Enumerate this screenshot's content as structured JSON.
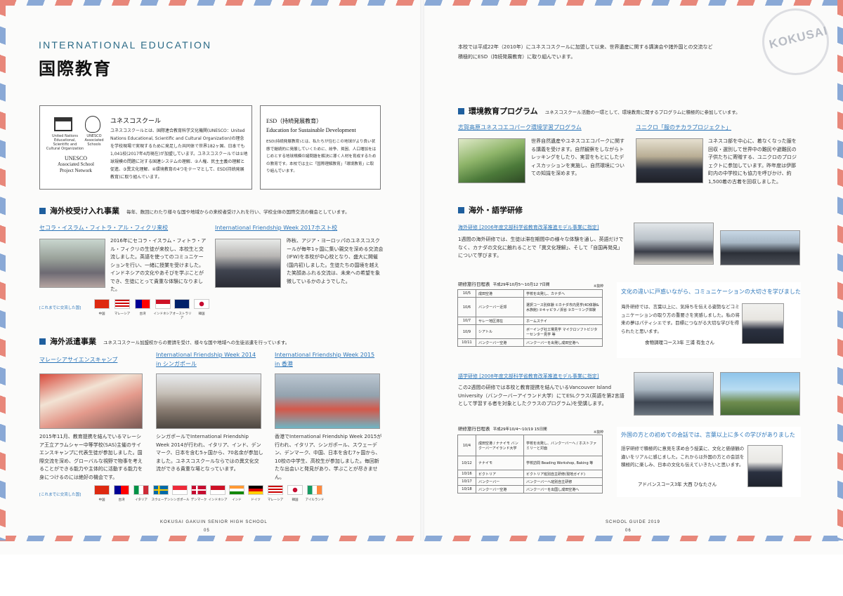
{
  "left_page": {
    "eng_title": "INTERNATIONAL EDUCATION",
    "jp_title": "国際教育",
    "unesco": {
      "logo_text_lines": [
        "United Nations",
        "Educational, Scientific and",
        "Cultural Organization"
      ],
      "assoc_logo_text_lines": [
        "UNESCO",
        "Associated",
        "Schools"
      ],
      "network_name_lines": [
        "UNESCO",
        "Associated School",
        "Project Network"
      ],
      "heading": "ユネスコスクール",
      "body": "ユネスコスクールとは、国際連合教育科学文化機関(UNESCO：United Nations Educational, Scientific and Cultural Organization)の理念を学校現場で実現するために発足した共同体で世界182ヶ国、日本でも1,041校(2017年4月現在)が加盟しています。ユネスコスクールでは①地球規模の問題に対する国連システムの理解、②人権、民主主義の理解と促進、③異文化理解、④環境教育の4つをテーマとして、ESD(持続発展教育)に取り組んでいます。"
    },
    "esd": {
      "heading_jp": "ESD（持続発展教育）",
      "heading_en": "Education for Sustainable Development",
      "body": "ESD(持続発展教育)とは、私たちが住むこの地球がより良い状態で継続的に発展していくために、紛争、貧困、人口増加をはじめとする地球規模の諸問題を解決に導く人材を育成するための教育です。本校では主に「国際理解教育」「環境教育」に取り組んでいます。"
    },
    "section1": {
      "title": "海外校受け入れ事業",
      "sub": "毎年、数回にわたり様々な国や地域からの来校者受け入れを行い、学校全体の国際交流の機会としています。",
      "a_link": "セコラ・イスラム・フィトラ・アル・フィクリ来校",
      "a_body": "2016年にセコラ・イスラム・フィトラ・アル・フィクリの生徒が来校し、本校生と交流しました。英語を使ってのコミュニケーションを行い、一緒に授業を受けました。インドネシアの文化やあそびを学ぶことができ、生徒にとって貴重な体験になりました。",
      "b_link": "International Friendship Week 2017ホスト校",
      "b_body": "昨秋、アジア・ヨーロッパのユネスコスクールが毎年1ヶ国に集い親交を深める交流会(IFW)を本校が中心校となり、盛大に開催(国内初)しました。生徒たちの国境を越えた笑顔あふれる交流は、未来への希望を象徴しているかのようでした。",
      "visited_label": "[これまでに交流した国]",
      "countries": [
        "中国",
        "マレーシア",
        "台湾",
        "インドネシア",
        "オーストラリア",
        "韓国"
      ]
    },
    "section2": {
      "title": "海外派遣事業",
      "sub": "ユネスコスクール加盟校からの要請を受け、様々な国や地域への生徒派遣を行っています。",
      "a_link": "マレーシアサイエンスキャンプ",
      "a_body": "2015年11月、教育提携を結んでいるマレーシア王立アラムシャー中等学校(SAS)主催のサイエンスキャンプに代表生徒が参加しました。国際交流を深め、グローバルな視野で物事を考えることができる能力や主体的に活動する能力を身につけるのには絶好の機会です。",
      "b_link_lines": [
        "International Friendship Week 2014",
        "in シンガポール"
      ],
      "b_body": "シンガポールでInternational Friendship Week 2014が行われ、イタリア、インド、デンマーク、日本を含む5ヶ国から、70名余が参加しました。ユネスコスクールならではの異文化交流ができる貴重な場となっています。",
      "c_link_lines": [
        "International Friendship Week 2015",
        "in 香港"
      ],
      "c_body": "香港でInternational Friendship Week 2015が行われ、イタリア、シンガポール、スウェーデン、デンマーク、中国、日本を含む7ヶ国から、10校の中学生、高校生が参加しました。毎回新たな出会いと発見があり、学ぶことが尽きません。",
      "visited_label": "[これまでに交流した国]",
      "countries": [
        "中国",
        "台湾",
        "イタリア",
        "スウェーデン",
        "シンガポール",
        "デンマーク",
        "インドネシア",
        "インド",
        "ドイツ",
        "マレーシア",
        "韓国",
        "アイルランド"
      ]
    },
    "footer_school": "KOKUSAI GAKUIN SENIOR HIGH SCHOOL",
    "page_no": "05"
  },
  "right_page": {
    "stamp_text": "KOKUSAI",
    "intro_lines": [
      "本校では平成22年（2010年）にユネスコスクールに加盟して以来、世界遺産に関する講演会や諸外国との交流など",
      "積極的にESD（持続発展教育）に取り組んでいます。"
    ],
    "env": {
      "title": "環境教育プログラム",
      "sub": "ユネスコスクール活動の一環として、環境教育に関するプログラムに積極的に参加しています。",
      "a_link": "志賀高原ユネスコエコパーク環境学習プログラム",
      "a_body": "世界自然遺産やユネスコエコパークに関する講義を受けます。自然観察をしながらトレッキングをしたり、実習をもとにしたディスカッションを実施し、自然環境についての知識を深めます。",
      "b_link": "ユニクロ「服のチカラプロジェクト」",
      "b_body": "ユネスコ部を中心に、着なくなった服を回収・選別して世界中の難民や避難民の子供たちに寄贈する、ユニクロのプロジェクトに参加しています。昨年度は伊那町内の中学校にも協力を呼びかけ、約1,500着の古着を回収しました。"
    },
    "lang": {
      "title": "海外・語学研修",
      "a_link": "海外研修 [2006年度文部科学省教育改革推進モデル事業に指定]",
      "a_body": "1週間の海外研修では、生徒は滞在期間中の様々な体験を通し、英語だけでなく、カナダの文化に触れることで「異文化理解」、そして「自国再発見」について学びます。",
      "sched1_title": "研修旅行日程表",
      "sched1_dates": "平成29年10月5〜10月12 7日間",
      "sched1_note": "※抜粋",
      "sched1_rows": [
        [
          "10/5",
          "成田空港",
          "学校を出発し、カナダへ"
        ],
        [
          "10/6",
          "バンクーバー近郊",
          "選択コース別体験 ①カナダ市内見学(4D体験&水族館) ②キャピラノ渓谷 ③カーリング体験"
        ],
        [
          "10/7",
          "サレー地区滞在",
          "ホームステイ"
        ],
        [
          "10/9",
          "シアトル",
          "ボーイング社工場見学 マイクロソフトビジターセンター見学 等"
        ],
        [
          "10/11",
          "バンクーバー空港",
          "バンクーバーを出発し成田空港へ"
        ]
      ],
      "quote1_h": "文化の違いに戸惑いながら、コミュニケーションの大切さを学びました",
      "quote1_body": "海外研修では、言葉以上に、気持ちを伝える姿勢などコミュニケーションの取り方の重要さを実感しました。私の将来の夢はパティシエです。目標につながる大切な学びを得られたと思います。",
      "quote1_sig": "食物調理コース3年 三浦 有生さん",
      "b_link": "語学研修 [2008年度文部科学省教育改革推進モデル事業に指定]",
      "b_body": "この2週間の研修では本校と教育提携を結んでいるVancouver Island University（バンクーバーアイランド大学）にてESLクラス(英語を第2言語として学習する者を対象としたクラスのプログラム)を受講します。",
      "sched2_title": "研修旅行日程表",
      "sched2_dates": "平成29年10/4〜10/19 15日間",
      "sched2_note": "※抜粋",
      "sched2_rows": [
        [
          "10/4",
          "成田空港 / ナナイモ バンクーバーアイランド大学",
          "学校を出発し、バンクーバーへ / ホストファミリーと対面"
        ],
        [
          "10/12",
          "ナナイモ",
          "学校訪問 Beading Workshop, Baking 等"
        ],
        [
          "10/16",
          "ビクトリア",
          "ビクトリア班別自主研修(現地ガイド)"
        ],
        [
          "10/17",
          "バンクーバー",
          "バンクーバーへ班別自主研修"
        ],
        [
          "10/18",
          "バンクーバー空港",
          "バンクーバーを出国し成田空港へ"
        ]
      ],
      "quote2_h": "外国の方との初めての会話では、言葉以上に多くの学びがありました",
      "quote2_body": "語学研修で積極的に意見を求め合う授業に、文化と価値観の違いをリアルに感じました。これからは外国の方との会話を積極的に楽しみ、日本の文化も伝えていきたいと思います。",
      "quote2_sig": "アドバンスコース3年 大西 ひなたさん"
    },
    "footer_guide": "SCHOOL GUIDE 2019",
    "page_no": "06"
  },
  "colors": {
    "accent": "#2a6a86",
    "link": "#2a74b8",
    "square": "#1f5f9e",
    "stripe_red": "#e8877a",
    "stripe_blue": "#8aa9d6"
  }
}
